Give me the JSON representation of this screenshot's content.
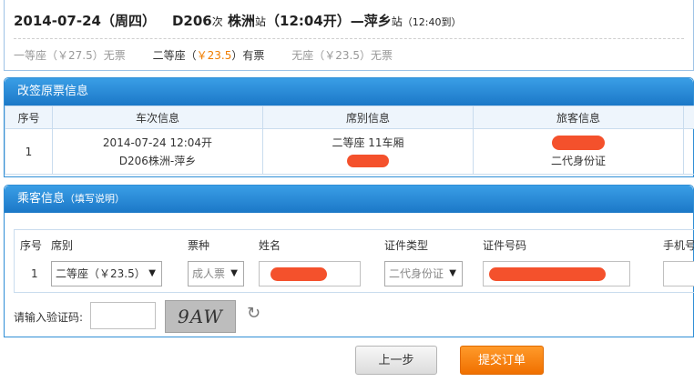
{
  "train": {
    "date": "2014-07-24",
    "weekday": "（周四）",
    "train_no": "D206",
    "train_suffix": "次",
    "from_station": "株洲",
    "station_suffix": "站",
    "depart": "（12:04开）",
    "dash": "—",
    "to_station": "萍乡",
    "arrive": "（12:40到）",
    "seats": [
      {
        "name": "一等座（",
        "price": "￥27.5",
        "close": "）",
        "status": "无票",
        "available": false
      },
      {
        "name": "二等座（",
        "price": "￥23.5",
        "close": "）",
        "status": "有票",
        "available": true
      },
      {
        "name": "无座（",
        "price": "￥23.5",
        "close": "）",
        "status": "无票",
        "available": false
      }
    ]
  },
  "original_ticket": {
    "title": "改签原票信息",
    "headers": [
      "序号",
      "车次信息",
      "席别信息",
      "旅客信息"
    ],
    "row": {
      "index": "1",
      "train_line1": "2014-07-24 12:04开",
      "train_line2": "D206株洲-萍乡",
      "seat_line1": "二等座 11车厢",
      "passenger_line2": "二代身份证"
    }
  },
  "passenger": {
    "title": "乘客信息",
    "note": "（填写说明）",
    "headers": {
      "index": "序号",
      "seat": "席别",
      "ticket_type": "票种",
      "name": "姓名",
      "id_type": "证件类型",
      "id_number": "证件号码",
      "phone": "手机号"
    },
    "row": {
      "index": "1",
      "seat_value": "二等座（￥23.5）",
      "ticket_type_value": "成人票",
      "id_type_value": "二代身份证"
    },
    "captcha_label": "请输入验证码:",
    "captcha_text": "9AW"
  },
  "buttons": {
    "prev": "上一步",
    "submit": "提交订单"
  },
  "colors": {
    "accent": "#1b78c7",
    "price": "#f07d00",
    "submit": "#f07000"
  }
}
